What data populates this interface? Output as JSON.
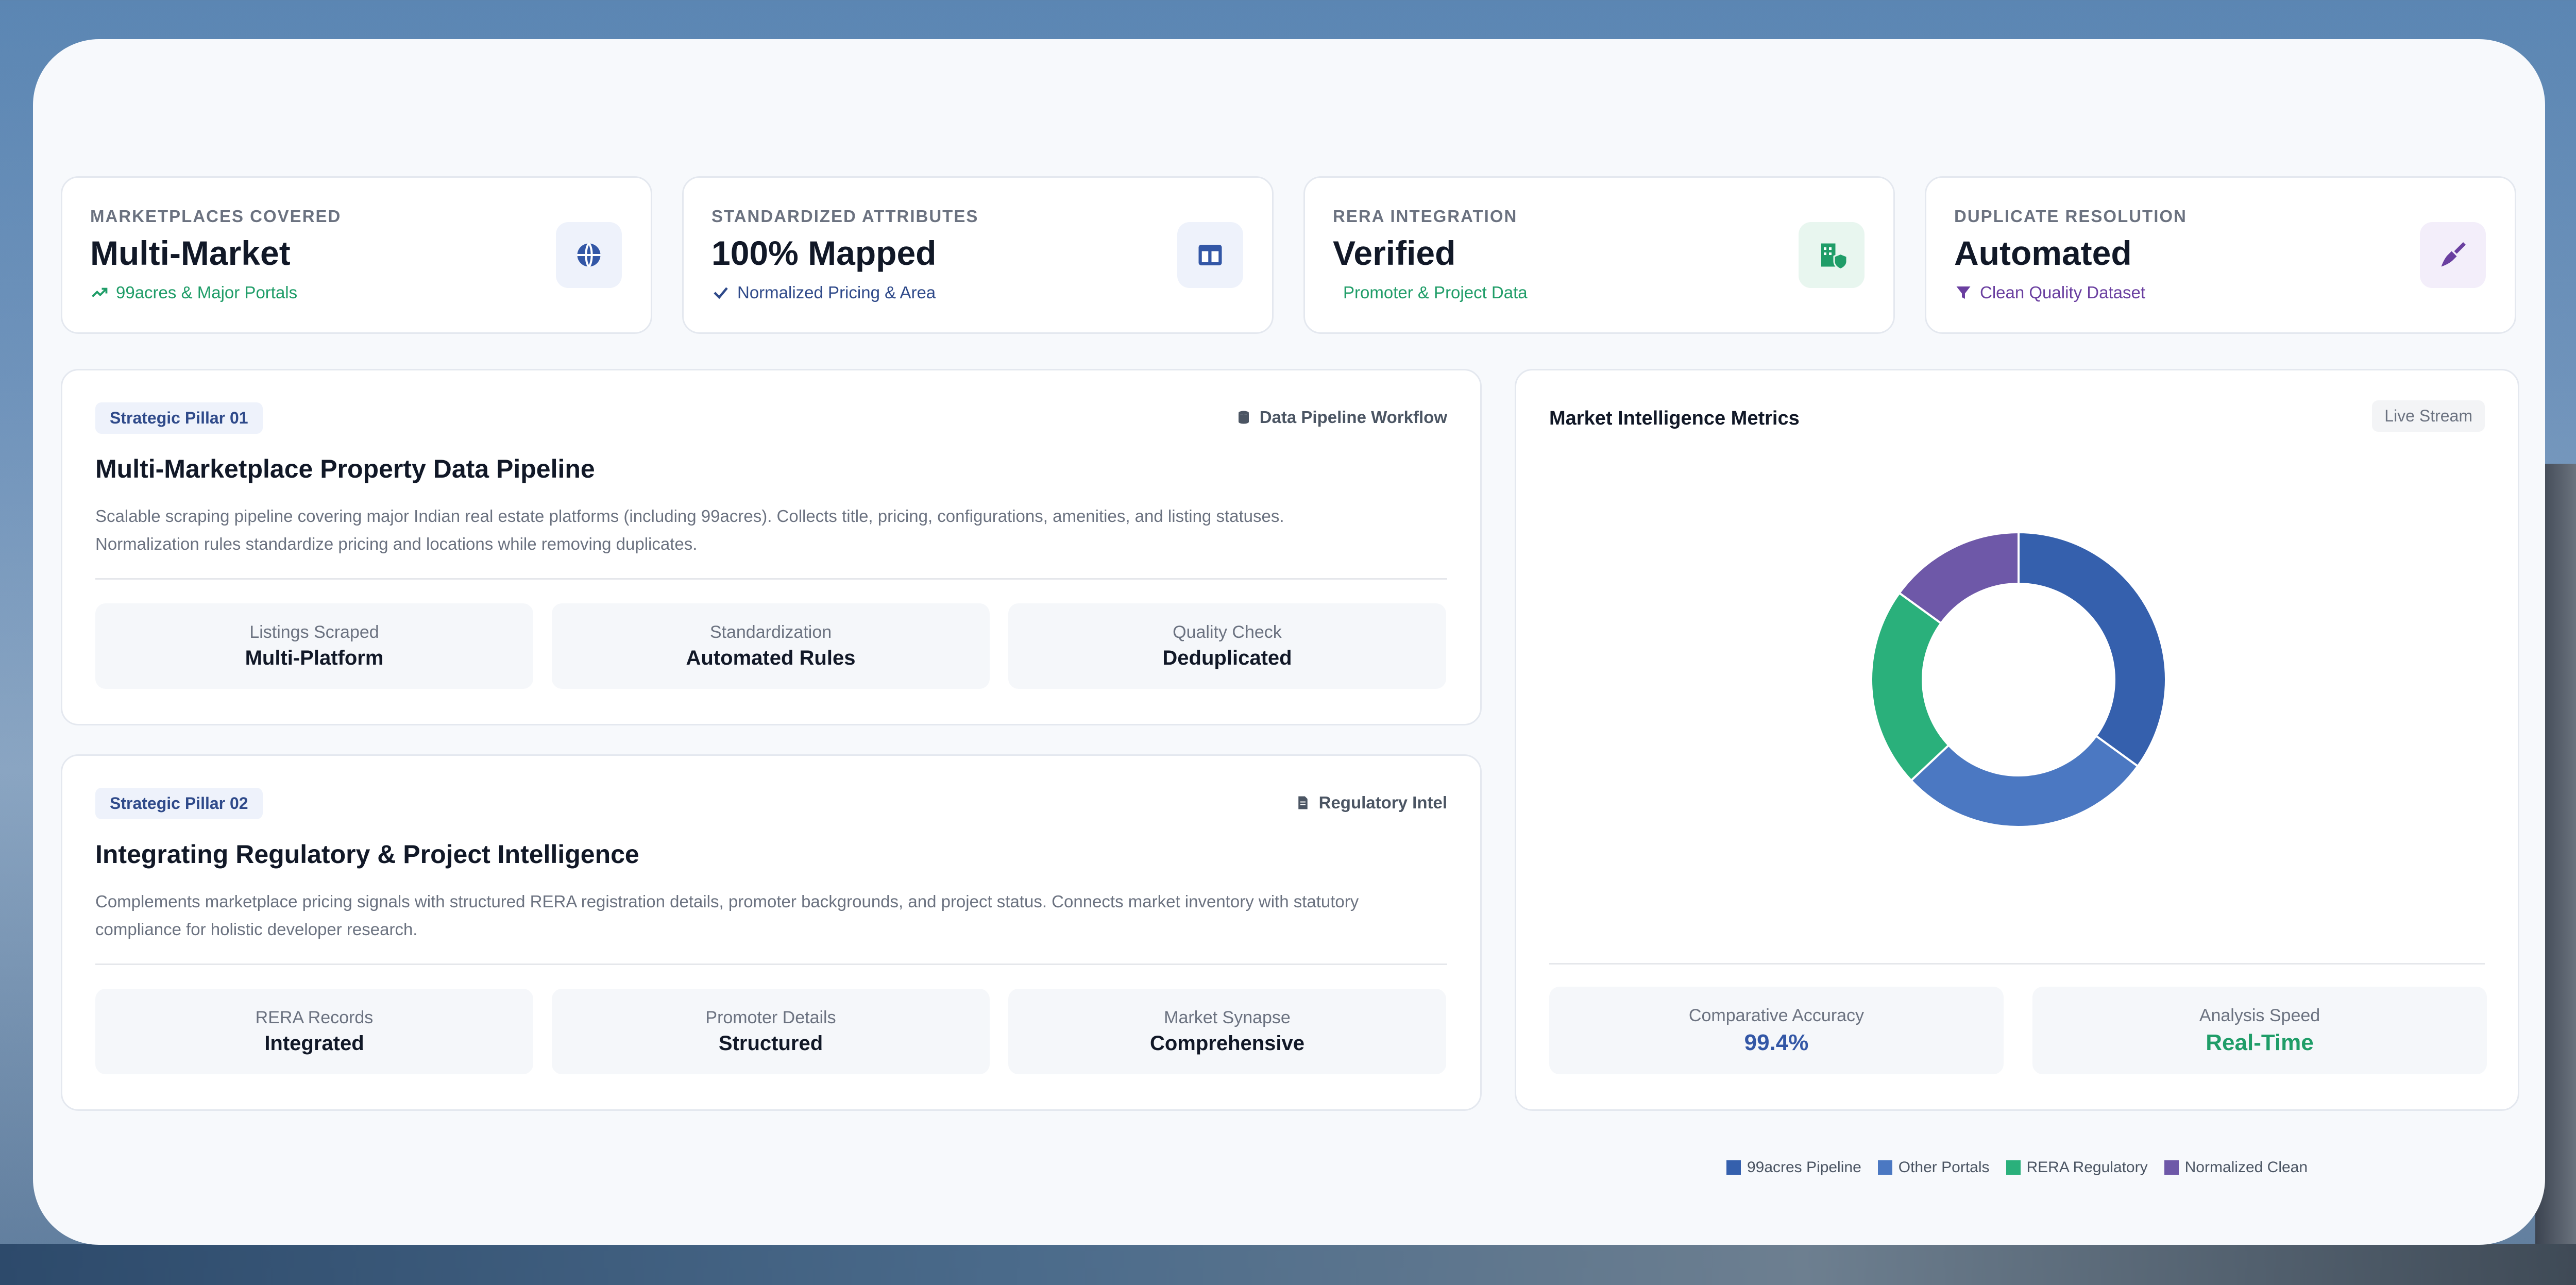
{
  "stats": [
    {
      "label": "MARKETPLACES COVERED",
      "value": "Multi-Market",
      "sub": "99acres & Major Portals",
      "sub_color": "#1f9d68",
      "icon": "globe-icon",
      "icon_bg": "#eef2fb",
      "icon_color": "#3357a6"
    },
    {
      "label": "STANDARDIZED ATTRIBUTES",
      "value": "100% Mapped",
      "sub": "Normalized Pricing & Area",
      "sub_color": "#2f4a8a",
      "icon": "layout-icon",
      "icon_bg": "#eef2fb",
      "icon_color": "#3357a6"
    },
    {
      "label": "RERA INTEGRATION",
      "value": "Verified",
      "sub": "Promoter & Project Data",
      "sub_color": "#1f9d68",
      "icon": "building-shield-icon",
      "icon_bg": "#e8f6ef",
      "icon_color": "#1f9d68"
    },
    {
      "label": "DUPLICATE RESOLUTION",
      "value": "Automated",
      "sub": "Clean Quality Dataset",
      "sub_color": "#6a3fa0",
      "icon": "broom-icon",
      "icon_bg": "#f3eefa",
      "icon_color": "#6a3fa0"
    }
  ],
  "pillar1": {
    "pill": "Strategic Pillar 01",
    "tag": "Data Pipeline Workflow",
    "title": "Multi-Marketplace Property Data Pipeline",
    "desc_line1": "Scalable scraping pipeline covering major Indian real estate platforms (including 99acres). Collects title, pricing, configurations, amenities, and listing statuses.",
    "desc_line2": "Normalization rules standardize pricing and locations while removing duplicates.",
    "minis": [
      {
        "label": "Listings Scraped",
        "value": "Multi-Platform"
      },
      {
        "label": "Standardization",
        "value": "Automated Rules"
      },
      {
        "label": "Quality Check",
        "value": "Deduplicated"
      }
    ]
  },
  "pillar2": {
    "pill": "Strategic Pillar 02",
    "tag": "Regulatory Intel",
    "title": "Integrating Regulatory & Project Intelligence",
    "desc_line1": "Complements marketplace pricing signals with structured RERA registration details, promoter backgrounds, and project status. Connects market inventory with statutory",
    "desc_line2": "compliance for holistic developer research.",
    "minis": [
      {
        "label": "RERA Records",
        "value": "Integrated"
      },
      {
        "label": "Promoter Details",
        "value": "Structured"
      },
      {
        "label": "Market Synapse",
        "value": "Comprehensive"
      }
    ]
  },
  "metrics": {
    "title": "Market Intelligence Metrics",
    "badge": "Live Stream",
    "accuracy_label": "Comparative Accuracy",
    "accuracy_value": "99.4%",
    "speed_label": "Analysis Speed",
    "speed_value": "Real-Time"
  },
  "chart_data": {
    "type": "pie",
    "series": [
      {
        "name": "99acres Pipeline",
        "value": 35,
        "color": "#3560ad"
      },
      {
        "name": "Other Portals",
        "value": 28,
        "color": "#4b78c2"
      },
      {
        "name": "RERA Regulatory",
        "value": 22,
        "color": "#2ab07b"
      },
      {
        "name": "Normalized Clean",
        "value": 15,
        "color": "#6e58a8"
      }
    ]
  }
}
